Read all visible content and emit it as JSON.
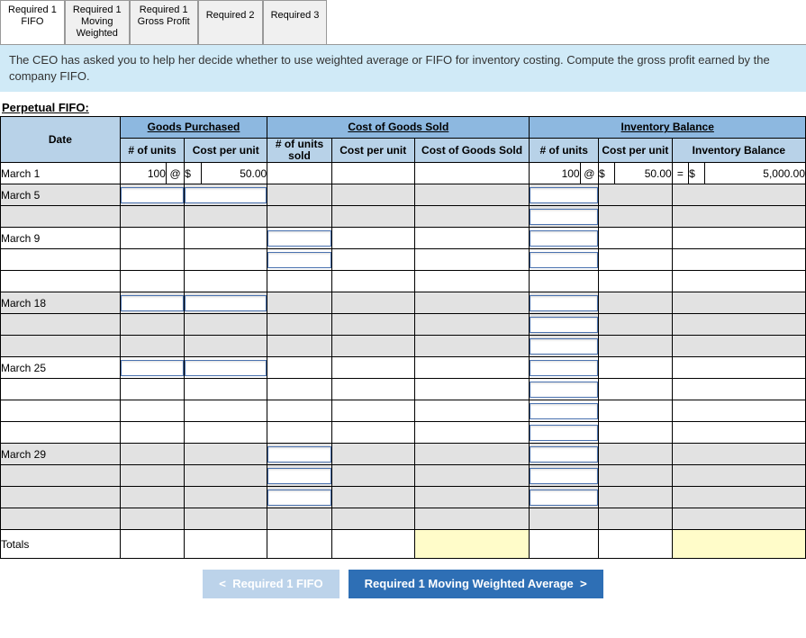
{
  "tabs": [
    {
      "l1": "Required 1",
      "l2": "FIFO",
      "active": true
    },
    {
      "l1": "Required 1",
      "l2": "Moving",
      "l3": "Weighted",
      "active": false
    },
    {
      "l1": "Required 1",
      "l2": "Gross Profit",
      "active": false
    },
    {
      "l1": "Required 2",
      "l2": "",
      "active": false
    },
    {
      "l1": "Required 3",
      "l2": "",
      "active": false
    }
  ],
  "instruction": "The CEO has asked you to help her decide whether to use weighted average or FIFO for inventory costing. Compute the gross profit earned by the company FIFO.",
  "section_title": "Perpetual FIFO:",
  "group_headers": {
    "goods": "Goods Purchased",
    "cogs": "Cost of Goods Sold",
    "inv": "Inventory Balance"
  },
  "col_headers": {
    "date": "Date",
    "gp_units": "# of units",
    "gp_cost": "Cost per unit",
    "cs_units": "# of units sold",
    "cs_cost": "Cost per unit",
    "cs_total": "Cost of Goods Sold",
    "ib_units": "# of units",
    "ib_cost": "Cost per unit",
    "ib_total": "Inventory Balance"
  },
  "row1": {
    "date": "March 1",
    "gp_units": "100",
    "gp_at": "@",
    "gp_cur": "$",
    "gp_cost": "50.00",
    "ib_units": "100",
    "ib_at": "@",
    "ib_cur": "$",
    "ib_cost": "50.00",
    "ib_eq": "=",
    "ib_cur2": "$",
    "ib_total": "5,000.00"
  },
  "dates": {
    "d5": "March 5",
    "d9": "March 9",
    "d18": "March 18",
    "d25": "March 25",
    "d29": "March 29",
    "totals": "Totals"
  },
  "nav": {
    "prev": "Required 1 FIFO",
    "next": "Required 1 Moving Weighted Average"
  }
}
